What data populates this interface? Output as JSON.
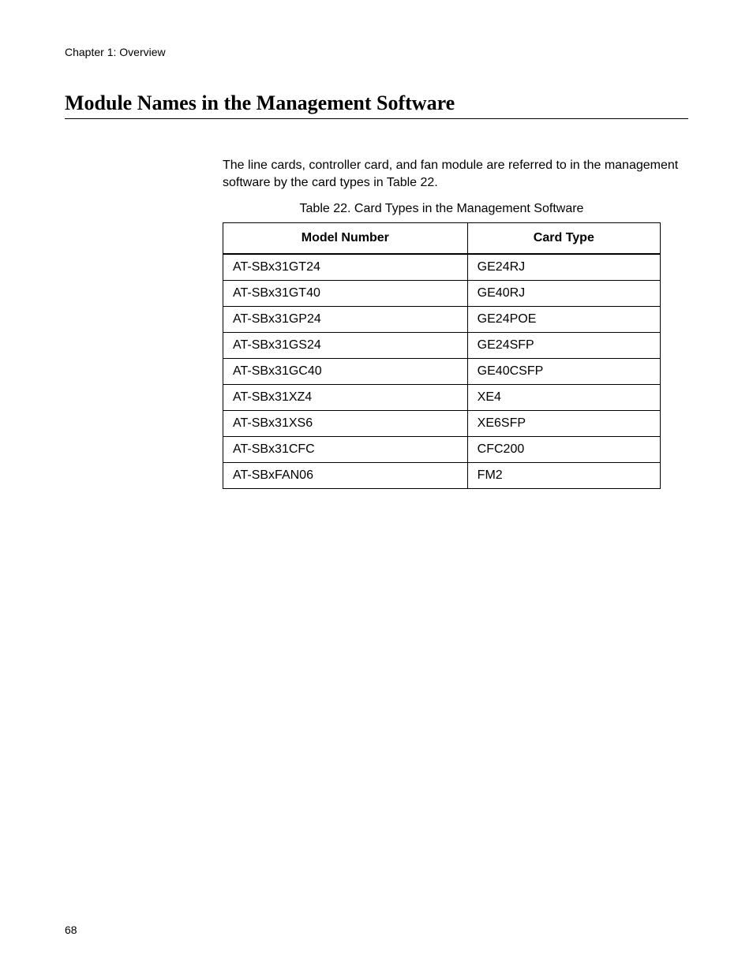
{
  "header": {
    "chapter": "Chapter 1: Overview"
  },
  "section": {
    "title": "Module Names in the Management Software"
  },
  "body": {
    "paragraph": "The line cards, controller card, and fan module are referred to in the management software by the card types in Table 22."
  },
  "table": {
    "caption": "Table 22.   Card Types in the Management Software",
    "headers": {
      "col1": "Model Number",
      "col2": "Card Type"
    },
    "rows": [
      {
        "model": "AT-SBx31GT24",
        "card": "GE24RJ"
      },
      {
        "model": "AT-SBx31GT40",
        "card": "GE40RJ"
      },
      {
        "model": "AT-SBx31GP24",
        "card": "GE24POE"
      },
      {
        "model": "AT-SBx31GS24",
        "card": "GE24SFP"
      },
      {
        "model": "AT-SBx31GC40",
        "card": "GE40CSFP"
      },
      {
        "model": "AT-SBx31XZ4",
        "card": "XE4"
      },
      {
        "model": "AT-SBx31XS6",
        "card": "XE6SFP"
      },
      {
        "model": "AT-SBx31CFC",
        "card": "CFC200"
      },
      {
        "model": "AT-SBxFAN06",
        "card": "FM2"
      }
    ]
  },
  "footer": {
    "page_number": "68"
  },
  "chart_data": {
    "type": "table",
    "title": "Card Types in the Management Software",
    "columns": [
      "Model Number",
      "Card Type"
    ],
    "data": [
      [
        "AT-SBx31GT24",
        "GE24RJ"
      ],
      [
        "AT-SBx31GT40",
        "GE40RJ"
      ],
      [
        "AT-SBx31GP24",
        "GE24POE"
      ],
      [
        "AT-SBx31GS24",
        "GE24SFP"
      ],
      [
        "AT-SBx31GC40",
        "GE40CSFP"
      ],
      [
        "AT-SBx31XZ4",
        "XE4"
      ],
      [
        "AT-SBx31XS6",
        "XE6SFP"
      ],
      [
        "AT-SBx31CFC",
        "CFC200"
      ],
      [
        "AT-SBxFAN06",
        "FM2"
      ]
    ]
  }
}
